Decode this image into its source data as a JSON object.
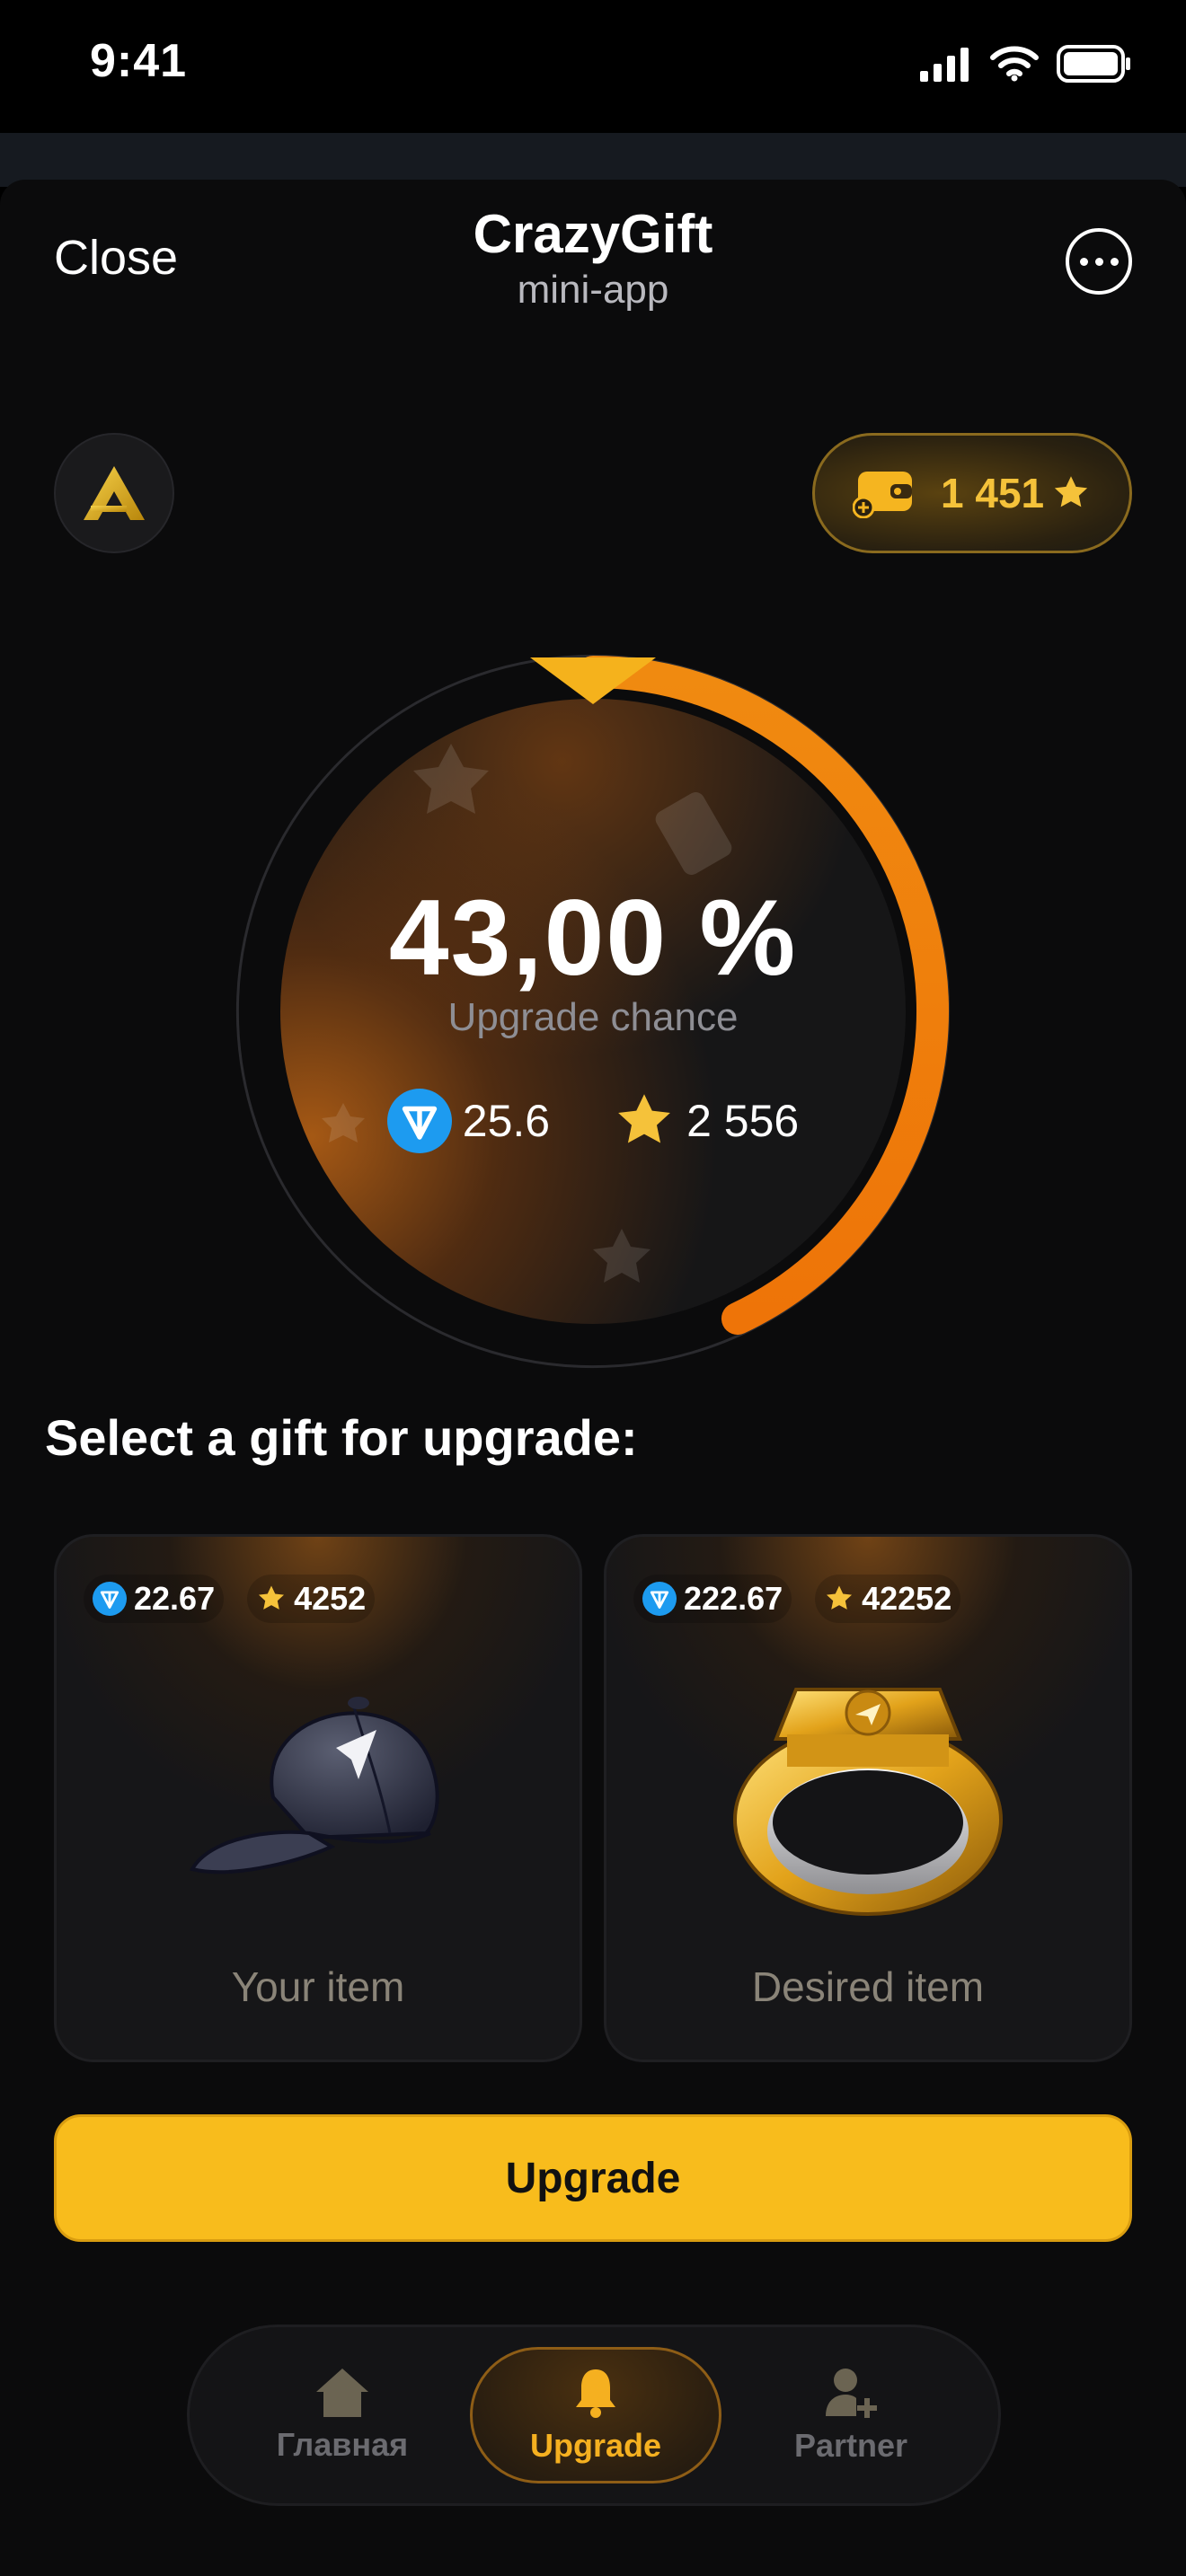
{
  "status_bar": {
    "time": "9:41",
    "icons": [
      "signal-icon",
      "wifi-icon",
      "battery-icon"
    ]
  },
  "header": {
    "close_label": "Close",
    "title": "CrazyGift",
    "subtitle": "mini-app",
    "more_icon": "ellipsis-icon"
  },
  "balance": {
    "value": "1 451",
    "icon": "wallet-add-icon",
    "currency_icon": "star-icon"
  },
  "upgrade_dial": {
    "chance": "43,00 %",
    "chance_label": "Upgrade chance",
    "chance_fraction": 0.43,
    "ton_price": "25.6",
    "star_price": "2 556"
  },
  "section_title": "Select a gift for upgrade:",
  "cards": [
    {
      "ton": "22.67",
      "stars": "4252",
      "label": "Your item",
      "art": "cap-icon"
    },
    {
      "ton": "222.67",
      "stars": "42252",
      "label": "Desired item",
      "art": "ring-icon"
    }
  ],
  "upgrade_button": "Upgrade",
  "nav": [
    {
      "label": "Главная",
      "icon": "home-icon",
      "active": false
    },
    {
      "label": "Upgrade",
      "icon": "bell-icon",
      "active": true
    },
    {
      "label": "Partner",
      "icon": "add-user-icon",
      "active": false
    }
  ],
  "colors": {
    "accent": "#f8bc1c",
    "arc": "#f07c0c",
    "ton": "#1d9bf0",
    "star": "#f5c23a",
    "background": "#0b0b0c"
  }
}
